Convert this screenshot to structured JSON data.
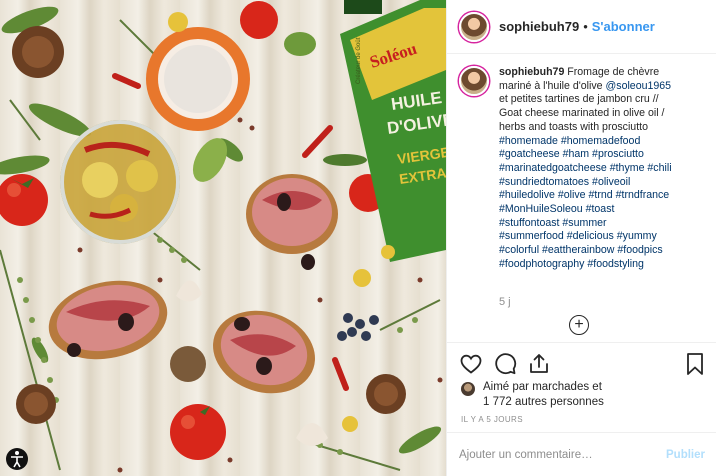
{
  "post": {
    "username": "sophiebuh79",
    "follow_label": "S'abonner",
    "separator": "•"
  },
  "caption": {
    "lines": [
      {
        "user": "sophiebuh79",
        "text": " Fromage de chèvre"
      },
      {
        "text": "mariné à l'huile d'olive ",
        "mention": "@soleou1965"
      },
      {
        "text": "et petites tartines de jambon cru //"
      },
      {
        "text": "Goat cheese marinated in olive oil /"
      },
      {
        "text": "herbs and toasts with prosciutto"
      },
      {
        "tags": "#homemade #homemadefood"
      },
      {
        "tags": "#goatcheese #ham #prosciutto"
      },
      {
        "tags": "#marinatedgoatcheese #thyme #chili"
      },
      {
        "tags": "#sundriedtomatoes #oliveoil"
      },
      {
        "tags": "#huiledolive #olive #trnd #trndfrance"
      },
      {
        "tags": "#MonHuileSoleou #toast"
      },
      {
        "tags": "#stuffontoast #summer"
      },
      {
        "tags": "#summerfood #delicious #yummy"
      },
      {
        "tags": "#colorful #eattherainbow #foodpics"
      },
      {
        "tags": "#foodphotography #foodstyling"
      }
    ],
    "age": "5 j",
    "load_more_symbol": "+"
  },
  "likes": {
    "line1": "Aimé par marchades et",
    "line2": "1 772 autres personnes"
  },
  "posted_time": "IL Y A 5 JOURS",
  "comment": {
    "placeholder": "Ajouter un commentaire…",
    "publish_label": "Publier"
  },
  "photo": {
    "bottle_brand": "Soléou",
    "bottle_tagline": "Créateur de Goût",
    "bottle_text_1": "HUILE",
    "bottle_text_2": "D'OLIVE",
    "bottle_text_3": "VIERGE",
    "bottle_text_4": "EXTRA"
  },
  "colors": {
    "link": "#003569",
    "follow": "#3897f0",
    "muted": "#8e8e8e",
    "publish_disabled": "#b2dffc",
    "bottle_green": "#3f8f2e",
    "tomato_red": "#d8261a"
  }
}
